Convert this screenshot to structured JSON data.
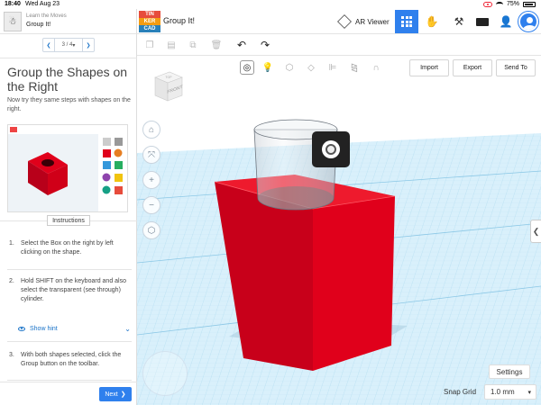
{
  "status": {
    "time": "18:40",
    "date": "Wed Aug 23",
    "battery": "75%"
  },
  "lesson": {
    "kicker": "Learn the Moves",
    "name": "Group It!",
    "page": "3 / 4",
    "title": "Group the Shapes on the Right",
    "description": "Now try they same steps with shapes on the right.",
    "instructions_label": "Instructions",
    "steps": [
      {
        "num": "1.",
        "text": "Select the Box on the right by left clicking on the shape."
      },
      {
        "num": "2.",
        "text": "Hold SHIFT on the keyboard and also select the transparent (see through) cylinder."
      },
      {
        "num": "3.",
        "text": "With both shapes selected, click the Group button on the toolbar."
      }
    ],
    "hint_label": "Show hint",
    "next_label": "Next"
  },
  "header": {
    "logo_letters": [
      "TIN",
      "KER",
      "CAD"
    ],
    "project_title": "Group It!",
    "ar_label": "AR Viewer"
  },
  "workspace": {
    "import_label": "Import",
    "export_label": "Export",
    "sendto_label": "Send To",
    "viewcube_face": "FRONT",
    "viewcube_top": "TOP",
    "settings_label": "Settings",
    "snap_label": "Snap Grid",
    "snap_value": "1.0 mm"
  },
  "colors": {
    "accent": "#2f80ed",
    "box_red": "#e0001b",
    "grid_bg": "#d6eefa",
    "grid_line": "#9fd2ee"
  }
}
